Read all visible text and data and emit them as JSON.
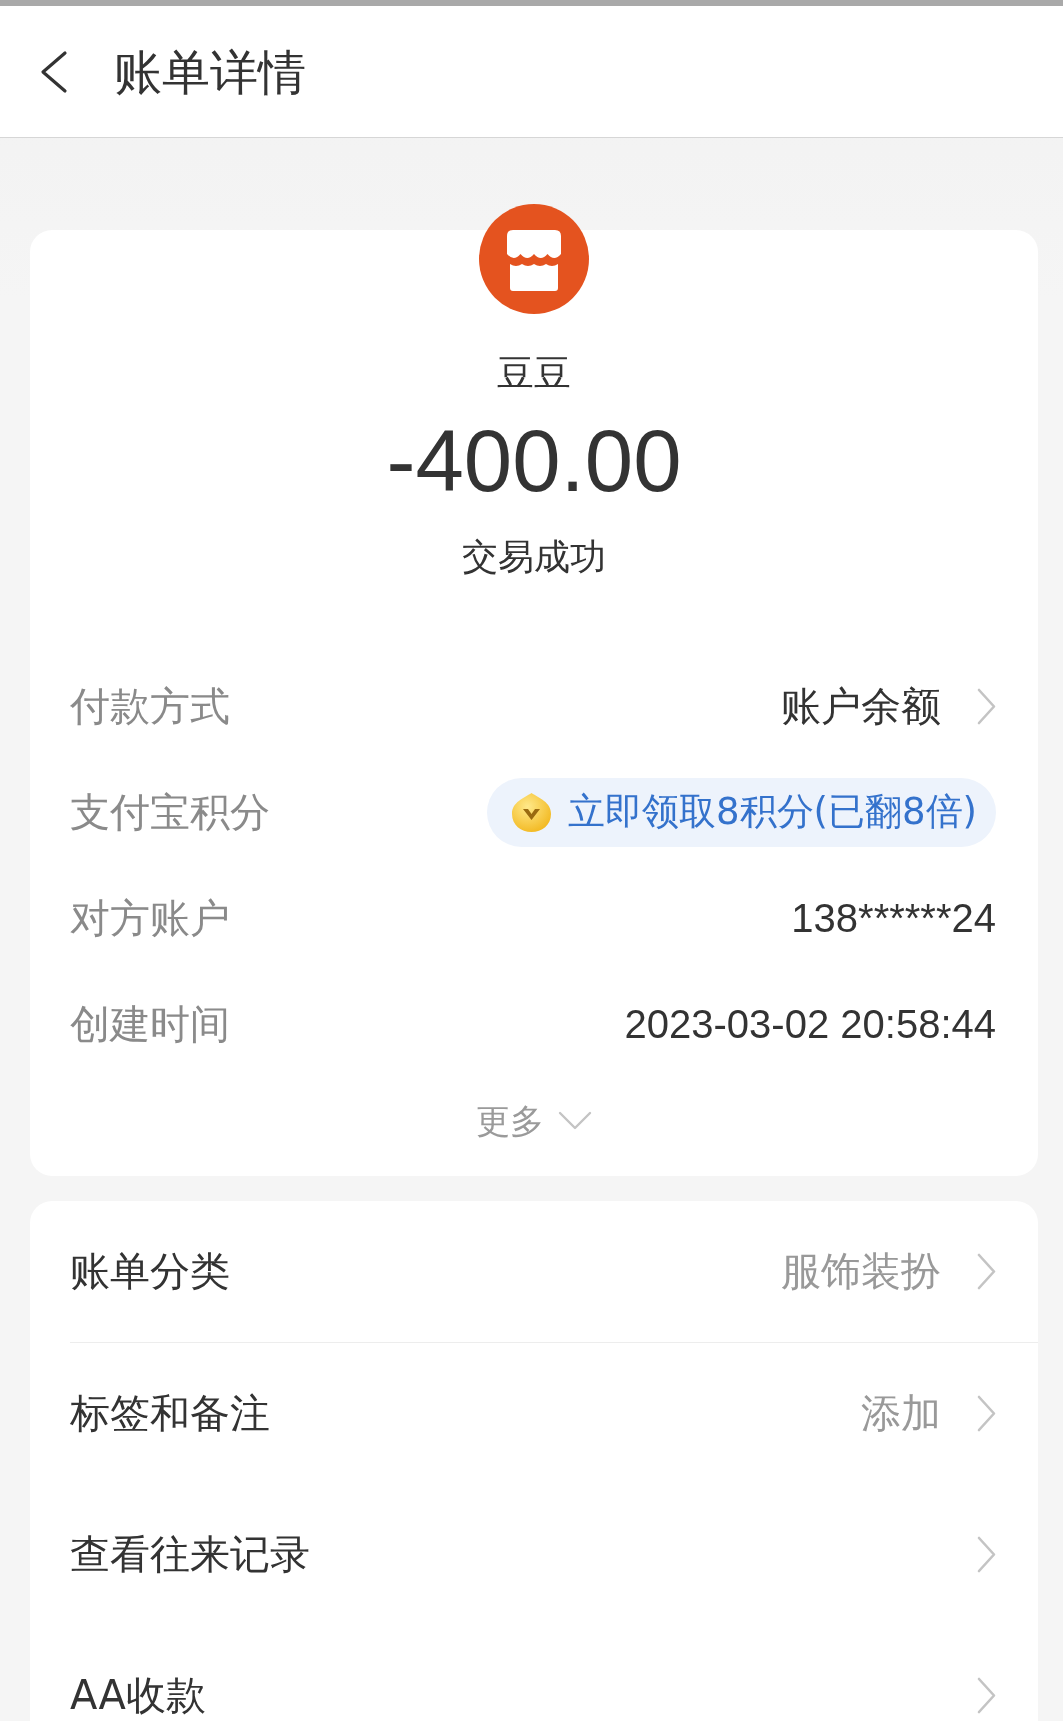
{
  "header": {
    "title": "账单详情"
  },
  "merchant": {
    "name": "豆豆",
    "amount": "-400.00",
    "status": "交易成功"
  },
  "details": [
    {
      "kind": "link",
      "label": "付款方式",
      "value": "账户余额"
    },
    {
      "kind": "points",
      "label": "支付宝积分",
      "value": "立即领取8积分(已翻8倍)"
    },
    {
      "kind": "text",
      "label": "对方账户",
      "value": "138******24"
    },
    {
      "kind": "text",
      "label": "创建时间",
      "value": "2023-03-02 20:58:44"
    }
  ],
  "more": {
    "label": "更多",
    "expanded": false
  },
  "action_groups": [
    {
      "items": [
        {
          "label": "账单分类",
          "value": "服饰装扮"
        }
      ]
    },
    {
      "items": [
        {
          "label": "标签和备注",
          "value": "添加"
        },
        {
          "label": "查看往来记录"
        },
        {
          "label": "AA收款"
        }
      ]
    }
  ]
}
